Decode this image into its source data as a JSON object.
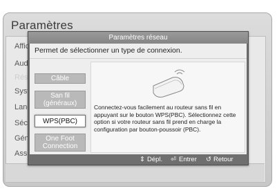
{
  "background": {
    "title": "Paramètres",
    "menu_items": [
      {
        "label": "Affichage",
        "dim": false
      },
      {
        "label": "Audio",
        "dim": false
      },
      {
        "label": "Réseau",
        "dim": true
      },
      {
        "label": "Système",
        "dim": false
      },
      {
        "label": "Langue",
        "dim": false
      },
      {
        "label": "Sécurité",
        "dim": false
      },
      {
        "label": "Général",
        "dim": false
      },
      {
        "label": "Assistance",
        "dim": false
      }
    ]
  },
  "dialog": {
    "title": "Paramètres réseau",
    "description": "Permet de sélectionner un type de connexion.",
    "options": [
      {
        "label": "Câble",
        "selected": false
      },
      {
        "label": "San fil (généraux)",
        "selected": false
      },
      {
        "label": "WPS(PBC)",
        "selected": true
      },
      {
        "label": "One Foot Connection",
        "selected": false
      }
    ],
    "info_text": "Connectez-vous facilement au routeur sans fil en appuyant sur le bouton WPS(PBC). Sélectionnez cette option si votre routeur sans fil prend en charge la configuration par bouton-poussoir (PBC).",
    "info_icon": "router-wps-icon",
    "footer": {
      "move_icon": "updown-icon",
      "move_label": "Dépl.",
      "enter_icon": "enter-icon",
      "enter_label": "Entrer",
      "return_icon": "return-icon",
      "return_label": "Retour"
    }
  }
}
